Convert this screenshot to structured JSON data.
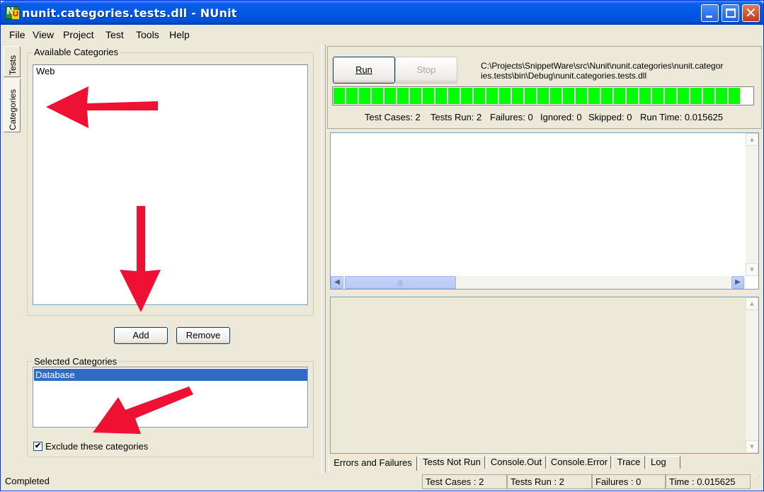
{
  "window": {
    "title": "nunit.categories.tests.dll - NUnit",
    "icon_label_n": "N",
    "icon_label_u": "U"
  },
  "menu": [
    {
      "label": "File"
    },
    {
      "label": "View"
    },
    {
      "label": "Project"
    },
    {
      "label": "Test"
    },
    {
      "label": "Tools"
    },
    {
      "label": "Help"
    }
  ],
  "side_tabs": [
    {
      "label": "Tests"
    },
    {
      "label": "Categories"
    }
  ],
  "categories_panel": {
    "available_label": "Available Categories",
    "available_items": [
      "Web"
    ],
    "add_label": "Add",
    "remove_label": "Remove",
    "selected_label": "Selected Categories",
    "selected_items": [
      "Database"
    ],
    "exclude_label": "Exclude these categories",
    "exclude_checked": true
  },
  "run_panel": {
    "run_label": "Run",
    "stop_label": "Stop",
    "path_line1": "C:\\Projects\\SnippetWare\\src\\Nunit\\nunit.categories\\nunit.categor",
    "path_line2": "ies.tests\\bin\\Debug\\nunit.categories.tests.dll",
    "progress_fraction": 1.0,
    "progress_color": "#00ff00",
    "stats": {
      "test_cases": "Test Cases: 2",
      "tests_run": "Tests Run: 2",
      "failures": "Failures: 0",
      "ignored": "Ignored: 0",
      "skipped": "Skipped: 0",
      "run_time": "Run Time: 0.015625"
    }
  },
  "bottom_tabs": [
    {
      "label": "Errors and Failures",
      "active": true
    },
    {
      "label": "Tests Not Run"
    },
    {
      "label": "Console.Out"
    },
    {
      "label": "Console.Error"
    },
    {
      "label": "Trace"
    },
    {
      "label": "Log"
    }
  ],
  "statusbar": {
    "status": "Completed",
    "test_cases": "Test Cases : 2",
    "tests_run": "Tests Run : 2",
    "failures": "Failures : 0",
    "time": "Time : 0.015625"
  },
  "colors": {
    "titlebar": "#0058e6",
    "selection": "#316ac5",
    "annotation_arrow": "#ee1133"
  }
}
